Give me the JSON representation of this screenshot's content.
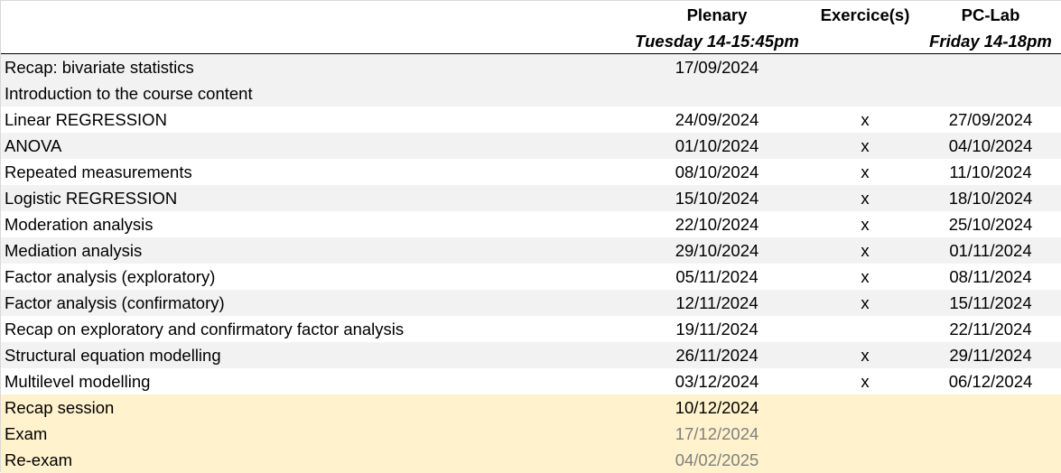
{
  "header": {
    "plenary": {
      "title": "Plenary",
      "subtitle": "Tuesday 14-15:45pm"
    },
    "exercise": {
      "title": "Exercice(s)",
      "subtitle": ""
    },
    "pclab": {
      "title": "PC-Lab",
      "subtitle": "Friday 14-18pm"
    }
  },
  "rows": [
    {
      "topic": "Recap: bivariate statistics",
      "plenary": "17/09/2024",
      "exercise": "",
      "pclab": "",
      "shade": "grey"
    },
    {
      "topic": "Introduction to the course content",
      "plenary": "",
      "exercise": "",
      "pclab": "",
      "shade": "grey"
    },
    {
      "topic": "Linear REGRESSION",
      "plenary": "24/09/2024",
      "exercise": "x",
      "pclab": "27/09/2024",
      "shade": "white"
    },
    {
      "topic": "ANOVA",
      "plenary": "01/10/2024",
      "exercise": "x",
      "pclab": "04/10/2024",
      "shade": "grey"
    },
    {
      "topic": "Repeated measurements",
      "plenary": "08/10/2024",
      "exercise": "x",
      "pclab": "11/10/2024",
      "shade": "white"
    },
    {
      "topic": "Logistic REGRESSION",
      "plenary": "15/10/2024",
      "exercise": "x",
      "pclab": "18/10/2024",
      "shade": "grey"
    },
    {
      "topic": "Moderation analysis",
      "plenary": "22/10/2024",
      "exercise": "x",
      "pclab": "25/10/2024",
      "shade": "white"
    },
    {
      "topic": "Mediation analysis",
      "plenary": "29/10/2024",
      "exercise": "x",
      "pclab": "01/11/2024",
      "shade": "grey"
    },
    {
      "topic": "Factor analysis (exploratory)",
      "plenary": "05/11/2024",
      "exercise": "x",
      "pclab": "08/11/2024",
      "shade": "white"
    },
    {
      "topic": "Factor analysis (confirmatory)",
      "plenary": "12/11/2024",
      "exercise": "x",
      "pclab": "15/11/2024",
      "shade": "grey"
    },
    {
      "topic": "Recap on exploratory and confirmatory factor analysis",
      "plenary": "19/11/2024",
      "exercise": "",
      "pclab": "22/11/2024",
      "shade": "white"
    },
    {
      "topic": "Structural equation modelling",
      "plenary": "26/11/2024",
      "exercise": "x",
      "pclab": "29/11/2024",
      "shade": "grey"
    },
    {
      "topic": "Multilevel modelling",
      "plenary": "03/12/2024",
      "exercise": "x",
      "pclab": "06/12/2024",
      "shade": "white"
    },
    {
      "topic": "Recap session",
      "plenary": "10/12/2024",
      "exercise": "",
      "pclab": "",
      "shade": "beige"
    },
    {
      "topic": "Exam",
      "plenary": "17/12/2024",
      "exercise": "",
      "pclab": "",
      "shade": "beige",
      "muted_date": true
    },
    {
      "topic": "Re-exam",
      "plenary": "04/02/2025",
      "exercise": "",
      "pclab": "",
      "shade": "beige",
      "muted_date": true
    }
  ],
  "colors": {
    "grey_row": "#f2f2f2",
    "white_row": "#ffffff",
    "beige_row": "#fff2cc",
    "muted_text": "#808080"
  }
}
